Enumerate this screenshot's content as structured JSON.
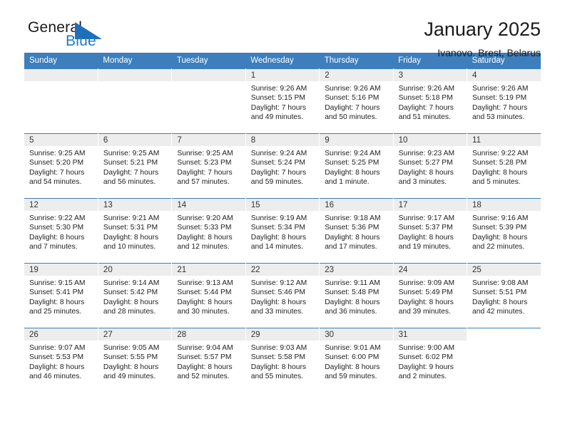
{
  "brand": {
    "word_one": "General",
    "word_two": "Blue",
    "flag_icon": "triangle-flag-icon",
    "accent_color": "#1f7ac4"
  },
  "header": {
    "title": "January 2025",
    "subtitle": "Ivanovo, Brest, Belarus"
  },
  "calendar": {
    "header_bg": "#3d7ebd",
    "daynum_bg": "#ededed",
    "weekday_headers": [
      "Sunday",
      "Monday",
      "Tuesday",
      "Wednesday",
      "Thursday",
      "Friday",
      "Saturday"
    ],
    "weeks": [
      [
        {
          "day": "",
          "lines": []
        },
        {
          "day": "",
          "lines": []
        },
        {
          "day": "",
          "lines": []
        },
        {
          "day": "1",
          "lines": [
            "Sunrise: 9:26 AM",
            "Sunset: 5:15 PM",
            "Daylight: 7 hours",
            "and 49 minutes."
          ]
        },
        {
          "day": "2",
          "lines": [
            "Sunrise: 9:26 AM",
            "Sunset: 5:16 PM",
            "Daylight: 7 hours",
            "and 50 minutes."
          ]
        },
        {
          "day": "3",
          "lines": [
            "Sunrise: 9:26 AM",
            "Sunset: 5:18 PM",
            "Daylight: 7 hours",
            "and 51 minutes."
          ]
        },
        {
          "day": "4",
          "lines": [
            "Sunrise: 9:26 AM",
            "Sunset: 5:19 PM",
            "Daylight: 7 hours",
            "and 53 minutes."
          ]
        }
      ],
      [
        {
          "day": "5",
          "lines": [
            "Sunrise: 9:25 AM",
            "Sunset: 5:20 PM",
            "Daylight: 7 hours",
            "and 54 minutes."
          ]
        },
        {
          "day": "6",
          "lines": [
            "Sunrise: 9:25 AM",
            "Sunset: 5:21 PM",
            "Daylight: 7 hours",
            "and 56 minutes."
          ]
        },
        {
          "day": "7",
          "lines": [
            "Sunrise: 9:25 AM",
            "Sunset: 5:23 PM",
            "Daylight: 7 hours",
            "and 57 minutes."
          ]
        },
        {
          "day": "8",
          "lines": [
            "Sunrise: 9:24 AM",
            "Sunset: 5:24 PM",
            "Daylight: 7 hours",
            "and 59 minutes."
          ]
        },
        {
          "day": "9",
          "lines": [
            "Sunrise: 9:24 AM",
            "Sunset: 5:25 PM",
            "Daylight: 8 hours",
            "and 1 minute."
          ]
        },
        {
          "day": "10",
          "lines": [
            "Sunrise: 9:23 AM",
            "Sunset: 5:27 PM",
            "Daylight: 8 hours",
            "and 3 minutes."
          ]
        },
        {
          "day": "11",
          "lines": [
            "Sunrise: 9:22 AM",
            "Sunset: 5:28 PM",
            "Daylight: 8 hours",
            "and 5 minutes."
          ]
        }
      ],
      [
        {
          "day": "12",
          "lines": [
            "Sunrise: 9:22 AM",
            "Sunset: 5:30 PM",
            "Daylight: 8 hours",
            "and 7 minutes."
          ]
        },
        {
          "day": "13",
          "lines": [
            "Sunrise: 9:21 AM",
            "Sunset: 5:31 PM",
            "Daylight: 8 hours",
            "and 10 minutes."
          ]
        },
        {
          "day": "14",
          "lines": [
            "Sunrise: 9:20 AM",
            "Sunset: 5:33 PM",
            "Daylight: 8 hours",
            "and 12 minutes."
          ]
        },
        {
          "day": "15",
          "lines": [
            "Sunrise: 9:19 AM",
            "Sunset: 5:34 PM",
            "Daylight: 8 hours",
            "and 14 minutes."
          ]
        },
        {
          "day": "16",
          "lines": [
            "Sunrise: 9:18 AM",
            "Sunset: 5:36 PM",
            "Daylight: 8 hours",
            "and 17 minutes."
          ]
        },
        {
          "day": "17",
          "lines": [
            "Sunrise: 9:17 AM",
            "Sunset: 5:37 PM",
            "Daylight: 8 hours",
            "and 19 minutes."
          ]
        },
        {
          "day": "18",
          "lines": [
            "Sunrise: 9:16 AM",
            "Sunset: 5:39 PM",
            "Daylight: 8 hours",
            "and 22 minutes."
          ]
        }
      ],
      [
        {
          "day": "19",
          "lines": [
            "Sunrise: 9:15 AM",
            "Sunset: 5:41 PM",
            "Daylight: 8 hours",
            "and 25 minutes."
          ]
        },
        {
          "day": "20",
          "lines": [
            "Sunrise: 9:14 AM",
            "Sunset: 5:42 PM",
            "Daylight: 8 hours",
            "and 28 minutes."
          ]
        },
        {
          "day": "21",
          "lines": [
            "Sunrise: 9:13 AM",
            "Sunset: 5:44 PM",
            "Daylight: 8 hours",
            "and 30 minutes."
          ]
        },
        {
          "day": "22",
          "lines": [
            "Sunrise: 9:12 AM",
            "Sunset: 5:46 PM",
            "Daylight: 8 hours",
            "and 33 minutes."
          ]
        },
        {
          "day": "23",
          "lines": [
            "Sunrise: 9:11 AM",
            "Sunset: 5:48 PM",
            "Daylight: 8 hours",
            "and 36 minutes."
          ]
        },
        {
          "day": "24",
          "lines": [
            "Sunrise: 9:09 AM",
            "Sunset: 5:49 PM",
            "Daylight: 8 hours",
            "and 39 minutes."
          ]
        },
        {
          "day": "25",
          "lines": [
            "Sunrise: 9:08 AM",
            "Sunset: 5:51 PM",
            "Daylight: 8 hours",
            "and 42 minutes."
          ]
        }
      ],
      [
        {
          "day": "26",
          "lines": [
            "Sunrise: 9:07 AM",
            "Sunset: 5:53 PM",
            "Daylight: 8 hours",
            "and 46 minutes."
          ]
        },
        {
          "day": "27",
          "lines": [
            "Sunrise: 9:05 AM",
            "Sunset: 5:55 PM",
            "Daylight: 8 hours",
            "and 49 minutes."
          ]
        },
        {
          "day": "28",
          "lines": [
            "Sunrise: 9:04 AM",
            "Sunset: 5:57 PM",
            "Daylight: 8 hours",
            "and 52 minutes."
          ]
        },
        {
          "day": "29",
          "lines": [
            "Sunrise: 9:03 AM",
            "Sunset: 5:58 PM",
            "Daylight: 8 hours",
            "and 55 minutes."
          ]
        },
        {
          "day": "30",
          "lines": [
            "Sunrise: 9:01 AM",
            "Sunset: 6:00 PM",
            "Daylight: 8 hours",
            "and 59 minutes."
          ]
        },
        {
          "day": "31",
          "lines": [
            "Sunrise: 9:00 AM",
            "Sunset: 6:02 PM",
            "Daylight: 9 hours",
            "and 2 minutes."
          ]
        },
        {
          "day": "",
          "lines": []
        }
      ]
    ]
  }
}
